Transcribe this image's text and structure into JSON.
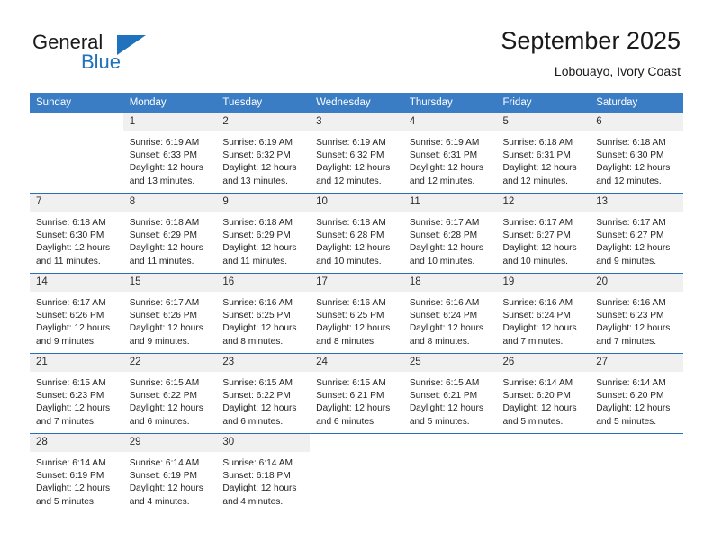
{
  "brand": {
    "name_part1": "General",
    "name_part2": "Blue",
    "icon": "triangle-logo-icon",
    "accent_color": "#1f72bb"
  },
  "header": {
    "title": "September 2025",
    "subtitle": "Lobouayo, Ivory Coast"
  },
  "calendar": {
    "header_bg": "#3b7dc4",
    "row_divider": "#2a6cb5",
    "daynum_bg": "#f0f0f0",
    "weekday_headers": [
      "Sunday",
      "Monday",
      "Tuesday",
      "Wednesday",
      "Thursday",
      "Friday",
      "Saturday"
    ],
    "weeks": [
      [
        {
          "day": "",
          "sunrise": "",
          "sunset": "",
          "daylight1": "",
          "daylight2": ""
        },
        {
          "day": "1",
          "sunrise": "Sunrise: 6:19 AM",
          "sunset": "Sunset: 6:33 PM",
          "daylight1": "Daylight: 12 hours",
          "daylight2": "and 13 minutes."
        },
        {
          "day": "2",
          "sunrise": "Sunrise: 6:19 AM",
          "sunset": "Sunset: 6:32 PM",
          "daylight1": "Daylight: 12 hours",
          "daylight2": "and 13 minutes."
        },
        {
          "day": "3",
          "sunrise": "Sunrise: 6:19 AM",
          "sunset": "Sunset: 6:32 PM",
          "daylight1": "Daylight: 12 hours",
          "daylight2": "and 12 minutes."
        },
        {
          "day": "4",
          "sunrise": "Sunrise: 6:19 AM",
          "sunset": "Sunset: 6:31 PM",
          "daylight1": "Daylight: 12 hours",
          "daylight2": "and 12 minutes."
        },
        {
          "day": "5",
          "sunrise": "Sunrise: 6:18 AM",
          "sunset": "Sunset: 6:31 PM",
          "daylight1": "Daylight: 12 hours",
          "daylight2": "and 12 minutes."
        },
        {
          "day": "6",
          "sunrise": "Sunrise: 6:18 AM",
          "sunset": "Sunset: 6:30 PM",
          "daylight1": "Daylight: 12 hours",
          "daylight2": "and 12 minutes."
        }
      ],
      [
        {
          "day": "7",
          "sunrise": "Sunrise: 6:18 AM",
          "sunset": "Sunset: 6:30 PM",
          "daylight1": "Daylight: 12 hours",
          "daylight2": "and 11 minutes."
        },
        {
          "day": "8",
          "sunrise": "Sunrise: 6:18 AM",
          "sunset": "Sunset: 6:29 PM",
          "daylight1": "Daylight: 12 hours",
          "daylight2": "and 11 minutes."
        },
        {
          "day": "9",
          "sunrise": "Sunrise: 6:18 AM",
          "sunset": "Sunset: 6:29 PM",
          "daylight1": "Daylight: 12 hours",
          "daylight2": "and 11 minutes."
        },
        {
          "day": "10",
          "sunrise": "Sunrise: 6:18 AM",
          "sunset": "Sunset: 6:28 PM",
          "daylight1": "Daylight: 12 hours",
          "daylight2": "and 10 minutes."
        },
        {
          "day": "11",
          "sunrise": "Sunrise: 6:17 AM",
          "sunset": "Sunset: 6:28 PM",
          "daylight1": "Daylight: 12 hours",
          "daylight2": "and 10 minutes."
        },
        {
          "day": "12",
          "sunrise": "Sunrise: 6:17 AM",
          "sunset": "Sunset: 6:27 PM",
          "daylight1": "Daylight: 12 hours",
          "daylight2": "and 10 minutes."
        },
        {
          "day": "13",
          "sunrise": "Sunrise: 6:17 AM",
          "sunset": "Sunset: 6:27 PM",
          "daylight1": "Daylight: 12 hours",
          "daylight2": "and 9 minutes."
        }
      ],
      [
        {
          "day": "14",
          "sunrise": "Sunrise: 6:17 AM",
          "sunset": "Sunset: 6:26 PM",
          "daylight1": "Daylight: 12 hours",
          "daylight2": "and 9 minutes."
        },
        {
          "day": "15",
          "sunrise": "Sunrise: 6:17 AM",
          "sunset": "Sunset: 6:26 PM",
          "daylight1": "Daylight: 12 hours",
          "daylight2": "and 9 minutes."
        },
        {
          "day": "16",
          "sunrise": "Sunrise: 6:16 AM",
          "sunset": "Sunset: 6:25 PM",
          "daylight1": "Daylight: 12 hours",
          "daylight2": "and 8 minutes."
        },
        {
          "day": "17",
          "sunrise": "Sunrise: 6:16 AM",
          "sunset": "Sunset: 6:25 PM",
          "daylight1": "Daylight: 12 hours",
          "daylight2": "and 8 minutes."
        },
        {
          "day": "18",
          "sunrise": "Sunrise: 6:16 AM",
          "sunset": "Sunset: 6:24 PM",
          "daylight1": "Daylight: 12 hours",
          "daylight2": "and 8 minutes."
        },
        {
          "day": "19",
          "sunrise": "Sunrise: 6:16 AM",
          "sunset": "Sunset: 6:24 PM",
          "daylight1": "Daylight: 12 hours",
          "daylight2": "and 7 minutes."
        },
        {
          "day": "20",
          "sunrise": "Sunrise: 6:16 AM",
          "sunset": "Sunset: 6:23 PM",
          "daylight1": "Daylight: 12 hours",
          "daylight2": "and 7 minutes."
        }
      ],
      [
        {
          "day": "21",
          "sunrise": "Sunrise: 6:15 AM",
          "sunset": "Sunset: 6:23 PM",
          "daylight1": "Daylight: 12 hours",
          "daylight2": "and 7 minutes."
        },
        {
          "day": "22",
          "sunrise": "Sunrise: 6:15 AM",
          "sunset": "Sunset: 6:22 PM",
          "daylight1": "Daylight: 12 hours",
          "daylight2": "and 6 minutes."
        },
        {
          "day": "23",
          "sunrise": "Sunrise: 6:15 AM",
          "sunset": "Sunset: 6:22 PM",
          "daylight1": "Daylight: 12 hours",
          "daylight2": "and 6 minutes."
        },
        {
          "day": "24",
          "sunrise": "Sunrise: 6:15 AM",
          "sunset": "Sunset: 6:21 PM",
          "daylight1": "Daylight: 12 hours",
          "daylight2": "and 6 minutes."
        },
        {
          "day": "25",
          "sunrise": "Sunrise: 6:15 AM",
          "sunset": "Sunset: 6:21 PM",
          "daylight1": "Daylight: 12 hours",
          "daylight2": "and 5 minutes."
        },
        {
          "day": "26",
          "sunrise": "Sunrise: 6:14 AM",
          "sunset": "Sunset: 6:20 PM",
          "daylight1": "Daylight: 12 hours",
          "daylight2": "and 5 minutes."
        },
        {
          "day": "27",
          "sunrise": "Sunrise: 6:14 AM",
          "sunset": "Sunset: 6:20 PM",
          "daylight1": "Daylight: 12 hours",
          "daylight2": "and 5 minutes."
        }
      ],
      [
        {
          "day": "28",
          "sunrise": "Sunrise: 6:14 AM",
          "sunset": "Sunset: 6:19 PM",
          "daylight1": "Daylight: 12 hours",
          "daylight2": "and 5 minutes."
        },
        {
          "day": "29",
          "sunrise": "Sunrise: 6:14 AM",
          "sunset": "Sunset: 6:19 PM",
          "daylight1": "Daylight: 12 hours",
          "daylight2": "and 4 minutes."
        },
        {
          "day": "30",
          "sunrise": "Sunrise: 6:14 AM",
          "sunset": "Sunset: 6:18 PM",
          "daylight1": "Daylight: 12 hours",
          "daylight2": "and 4 minutes."
        },
        {
          "day": "",
          "sunrise": "",
          "sunset": "",
          "daylight1": "",
          "daylight2": ""
        },
        {
          "day": "",
          "sunrise": "",
          "sunset": "",
          "daylight1": "",
          "daylight2": ""
        },
        {
          "day": "",
          "sunrise": "",
          "sunset": "",
          "daylight1": "",
          "daylight2": ""
        },
        {
          "day": "",
          "sunrise": "",
          "sunset": "",
          "daylight1": "",
          "daylight2": ""
        }
      ]
    ]
  }
}
